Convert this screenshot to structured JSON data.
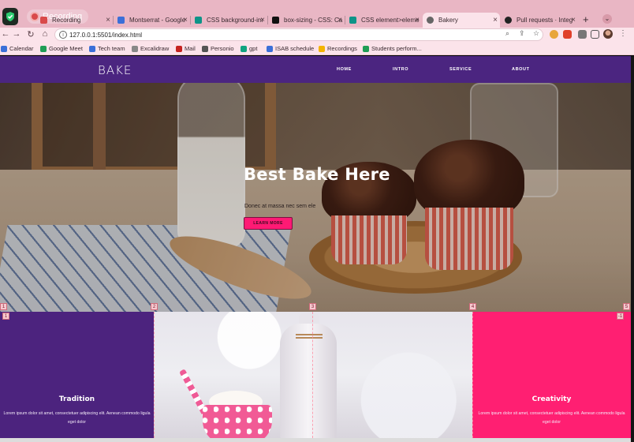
{
  "browser": {
    "recording_label": "Recording",
    "tabs": [
      {
        "label": "Recording",
        "fav_color": "#d94a4a",
        "active": false
      },
      {
        "label": "Montserrat - Google",
        "fav_color": "#3b6fd8",
        "active": false
      },
      {
        "label": "CSS background-im",
        "fav_color": "#0d9488",
        "active": false
      },
      {
        "label": "box-sizing - CSS: Ca",
        "fav_color": "#111111",
        "active": false
      },
      {
        "label": "CSS element>eleme",
        "fav_color": "#0d9488",
        "active": false
      },
      {
        "label": "Bakery",
        "fav_color": "#666666",
        "active": true
      },
      {
        "label": "Pull requests · Integ",
        "fav_color": "#222222",
        "active": false
      }
    ],
    "url": "127.0.0.1:5501/index.html",
    "bookmarks": [
      {
        "label": "Calendar",
        "color": "#3b6fd8"
      },
      {
        "label": "Google Meet",
        "color": "#1f9d55"
      },
      {
        "label": "Tech team",
        "color": "#3b6fd8"
      },
      {
        "label": "Excalidraw",
        "color": "#888888"
      },
      {
        "label": "Mail",
        "color": "#c5221f"
      },
      {
        "label": "Personio",
        "color": "#555555"
      },
      {
        "label": "gpt",
        "color": "#10a37f"
      },
      {
        "label": "ISAB schedule",
        "color": "#3b6fd8"
      },
      {
        "label": "Recordings",
        "color": "#f4b400"
      },
      {
        "label": "Students perform...",
        "color": "#1f9d55"
      }
    ]
  },
  "site": {
    "logo": "BAKE",
    "nav": [
      "HOME",
      "INTRO",
      "SERVICE",
      "ABOUT"
    ],
    "hero": {
      "title": "Best Bake Here",
      "subtitle": "Donec at massa nec sem ele",
      "button": "LEARN MORE"
    },
    "features": [
      {
        "title": "Tradition",
        "text": "Lorem ipsum dolor sit amet, consectetuer adipiscing elit. Aenean commodo ligula eget dolor"
      },
      {
        "title": "Creativity",
        "text": "Lorem ipsum dolor sit amet, consectetuer adipiscing elit. Aenean commodo ligula eget dolor"
      }
    ],
    "colors": {
      "purple": "#4b2580",
      "pink": "#ff1f72"
    }
  },
  "debug_grid": {
    "top_markers": [
      "1",
      "2",
      "3",
      "4",
      "5"
    ],
    "row_markers": [
      "1",
      "-1"
    ]
  }
}
